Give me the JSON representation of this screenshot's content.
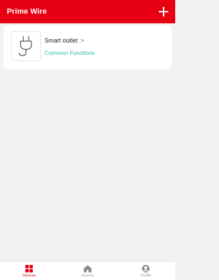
{
  "header": {
    "title": "Prime Wire",
    "add_icon": "plus-icon",
    "bg_color": "#e60012"
  },
  "devices": [
    {
      "name": "Smart outlet",
      "chevron": ">",
      "icon": "plug-icon",
      "link_label": "Common Functions",
      "link_color": "#2fb8a8"
    }
  ],
  "tabbar": {
    "tabs": [
      {
        "label": "Devices",
        "icon": "grid-icon",
        "active": true
      },
      {
        "label": "Scenes",
        "icon": "home-icon",
        "active": false
      },
      {
        "label": "Profile",
        "icon": "person-icon",
        "active": false
      }
    ],
    "active_color": "#e60012",
    "inactive_color": "#999999"
  }
}
